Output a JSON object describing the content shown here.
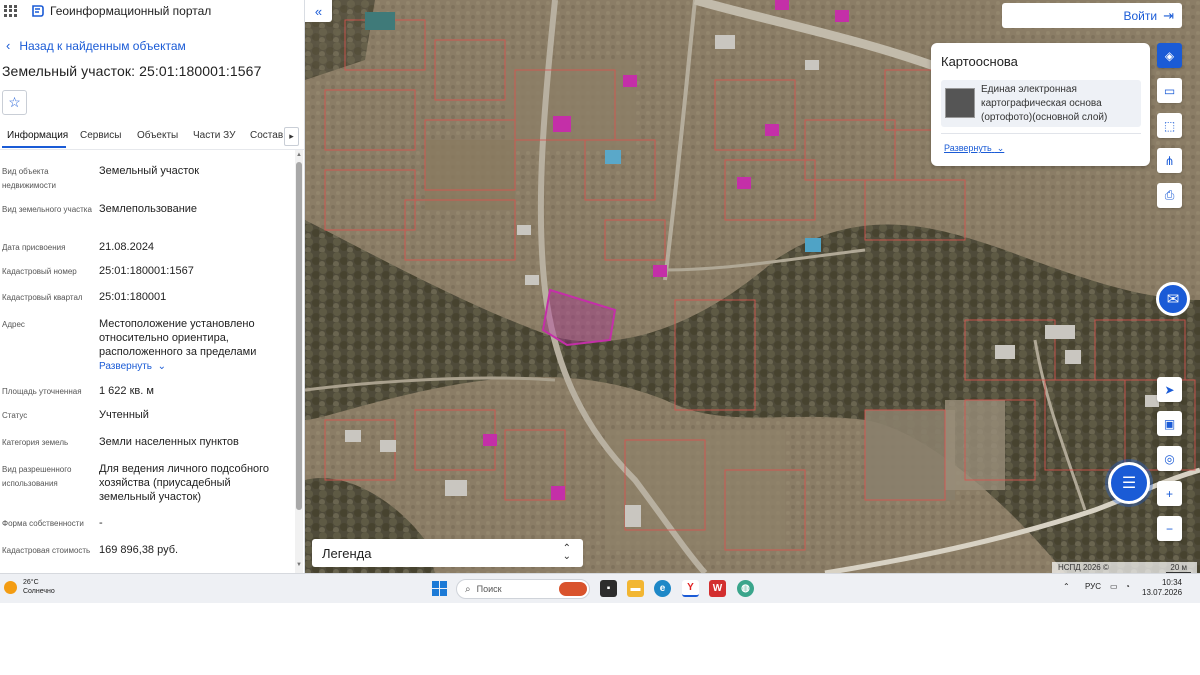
{
  "portal": {
    "title": "Геоинформационный портал"
  },
  "nav": {
    "back_label": "Назад к найденным объектам"
  },
  "parcel": {
    "title": "Земельный участок: 25:01:180001:1567"
  },
  "tabs": [
    {
      "label": "Информация",
      "active": true
    },
    {
      "label": "Сервисы"
    },
    {
      "label": "Объекты"
    },
    {
      "label": "Части ЗУ"
    },
    {
      "label": "Состав"
    }
  ],
  "props": [
    {
      "label": "Вид объекта недвижимости",
      "value": "Земельный участок"
    },
    {
      "label": "Вид земельного участка",
      "value": "Землепользование"
    },
    {
      "label": "Дата присвоения",
      "value": "21.08.2024"
    },
    {
      "label": "Кадастровый номер",
      "value": "25:01:180001:1567"
    },
    {
      "label": "Кадастровый квартал",
      "value": "25:01:180001"
    },
    {
      "label": "Адрес",
      "value": "Местоположение установлено относительно ориентира, расположенного за пределами",
      "expand": "Развернуть"
    },
    {
      "label": "Площадь уточненная",
      "value": "1 622 кв. м"
    },
    {
      "label": "Статус",
      "value": "Учтенный"
    },
    {
      "label": "Категория земель",
      "value": "Земли населенных пунктов"
    },
    {
      "label": "Вид разрешенного использования",
      "value": "Для ведения личного подсобного хозяйства (приусадебный земельный участок)"
    },
    {
      "label": "Форма собственности",
      "value": "-"
    },
    {
      "label": "Кадастровая стоимость",
      "value": "169 896,38 руб."
    }
  ],
  "login": {
    "label": "Войти"
  },
  "basemap": {
    "title": "Картооснова",
    "layer": "Единая электронная картографическая основа (ортофото)(основной слой)",
    "expand": "Развернуть"
  },
  "legend": {
    "label": "Легенда"
  },
  "attribution": {
    "text": "НСПД 2026 ©",
    "scale": "20 м"
  },
  "taskbar": {
    "temperature": "26°C",
    "weather": "Солнечно",
    "search_placeholder": "Поиск",
    "lang": "РУС",
    "time": "10:34",
    "date": "13.07.2026"
  },
  "colors": {
    "accent": "#1a5bd6",
    "parcel_selected": "#b0249a",
    "boundary": "#d9534f"
  }
}
